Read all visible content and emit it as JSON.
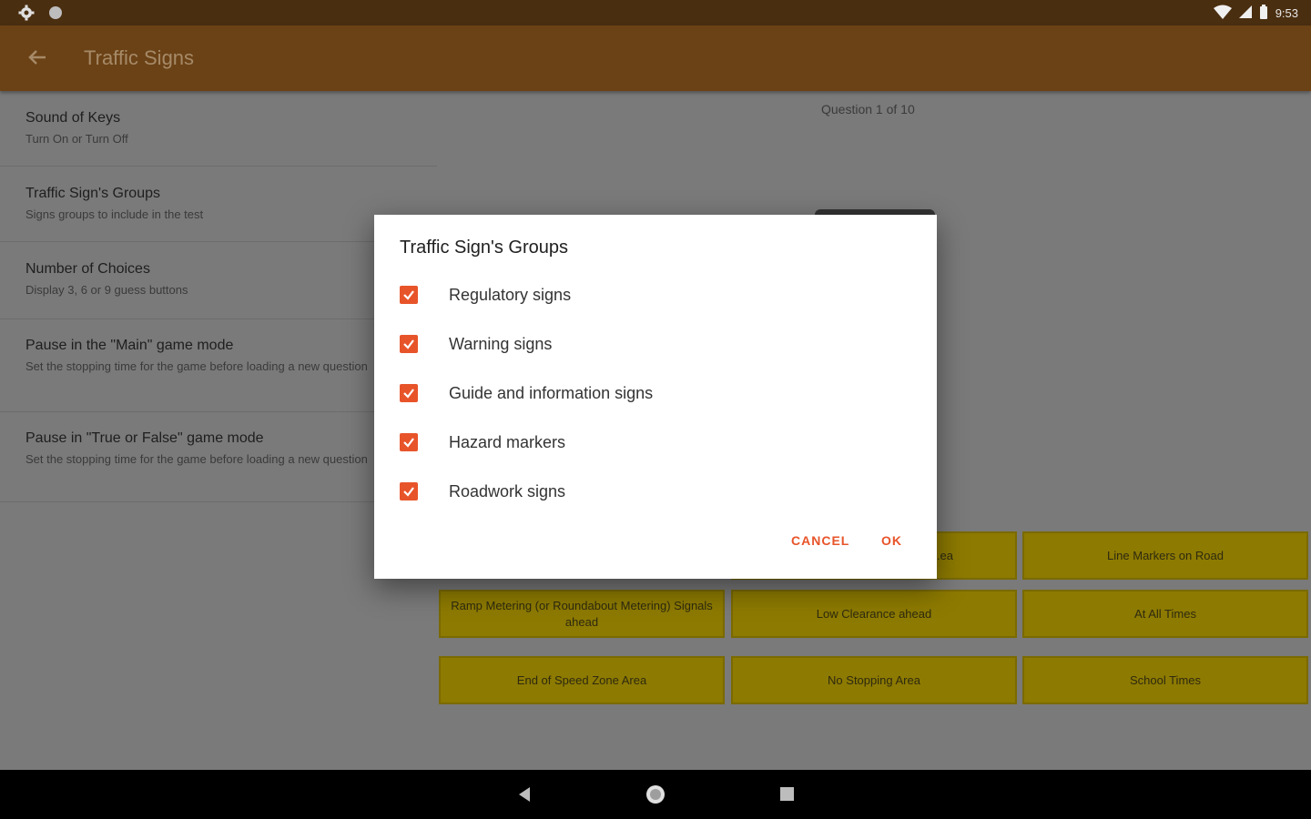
{
  "status": {
    "time": "9:53"
  },
  "appbar": {
    "title": "Traffic Signs"
  },
  "settings": [
    {
      "title": "Sound of Keys",
      "subtitle": "Turn On or Turn Off"
    },
    {
      "title": "Traffic Sign's Groups",
      "subtitle": "Signs groups to include in the test"
    },
    {
      "title": "Number of Choices",
      "subtitle": "Display 3, 6 or 9 guess buttons"
    },
    {
      "title": "Pause in the \"Main\" game mode",
      "subtitle": "Set the stopping time for the game before loading a new question"
    },
    {
      "title": "Pause in \"True or False\" game mode",
      "subtitle": "Set the stopping time for the game before loading a new question"
    }
  ],
  "game": {
    "question_label": "Question 1 of 10",
    "answers": [
      "...ea",
      "Line Markers on Road",
      "Ramp Metering (or Roundabout Metering) Signals ahead",
      "Low Clearance ahead",
      "At All Times",
      "End of Speed Zone Area",
      "No Stopping Area",
      "School Times"
    ]
  },
  "dialog": {
    "title": "Traffic Sign's Groups",
    "options": [
      {
        "label": "Regulatory signs",
        "checked": true
      },
      {
        "label": "Warning signs",
        "checked": true
      },
      {
        "label": "Guide and information signs",
        "checked": true
      },
      {
        "label": "Hazard markers",
        "checked": true
      },
      {
        "label": "Roadwork signs",
        "checked": true
      }
    ],
    "cancel_label": "CANCEL",
    "ok_label": "OK"
  },
  "colors": {
    "accent": "#e8542a",
    "appbar": "#6b4216",
    "answer_button": "#c8b400"
  }
}
